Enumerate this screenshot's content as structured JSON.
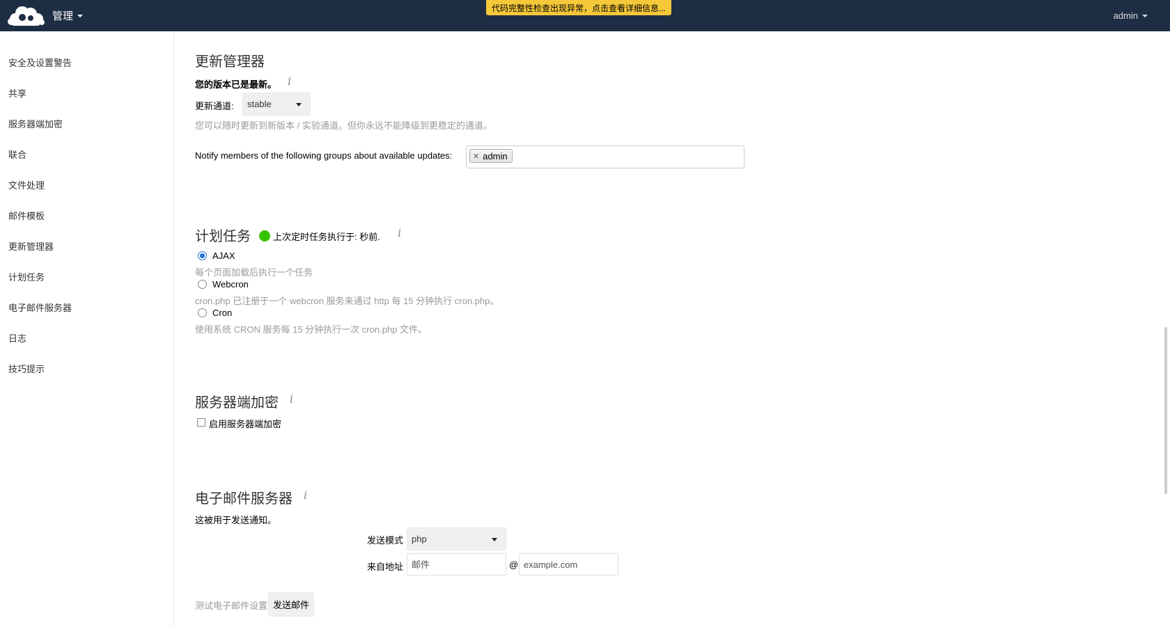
{
  "header": {
    "app_menu_label": "管理",
    "integrity_warning": "代码完整性检查出现异常，点击查看详细信息...",
    "user": "admin"
  },
  "sidebar": {
    "items": [
      {
        "label": "安全及设置警告"
      },
      {
        "label": "共享"
      },
      {
        "label": "服务器端加密"
      },
      {
        "label": "联合"
      },
      {
        "label": "文件处理"
      },
      {
        "label": "邮件模板"
      },
      {
        "label": "更新管理器"
      },
      {
        "label": "计划任务"
      },
      {
        "label": "电子邮件服务器"
      },
      {
        "label": "日志"
      },
      {
        "label": "技巧提示"
      }
    ]
  },
  "updater": {
    "title": "更新管理器",
    "status": "您的版本已是最新。",
    "channel_label": "更新通道:",
    "channel_value": "stable",
    "channel_hint": "您可以随时更新到新版本 / 实验通道。但你永远不能降级到更稳定的通道。",
    "notify_label": "Notify members of the following groups about available updates:",
    "notify_groups": [
      "admin"
    ]
  },
  "cron": {
    "title": "计划任务",
    "last_run": "上次定时任务执行于: 秒前.",
    "options": [
      {
        "label": "AJAX",
        "hint": "每个页面加载后执行一个任务",
        "checked": true
      },
      {
        "label": "Webcron",
        "hint": "cron.php 已注册于一个 webcron 服务来通过 http 每 15 分钟执行 cron.php。",
        "checked": false
      },
      {
        "label": "Cron",
        "hint": "使用系统 CRON 服务每 15 分钟执行一次 cron.php 文件。",
        "checked": false
      }
    ]
  },
  "encryption": {
    "title": "服务器端加密",
    "enable_label": "启用服务器端加密"
  },
  "mail": {
    "title": "电子邮件服务器",
    "description": "这被用于发送通知。",
    "send_mode_label": "发送模式",
    "send_mode_value": "php",
    "from_label": "来自地址",
    "from_placeholder": "邮件",
    "at": "@",
    "domain_placeholder": "example.com",
    "test_label": "测试电子邮件设置",
    "send_button": "发送邮件"
  },
  "icons": {
    "info": "i"
  }
}
